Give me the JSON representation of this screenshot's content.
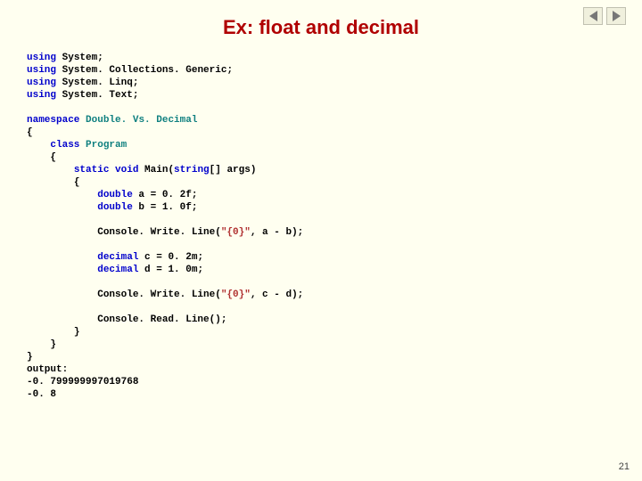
{
  "title": "Ex: float and decimal",
  "nav": {
    "prev_icon": "◄",
    "next_icon": "►"
  },
  "code": {
    "kw_using": "using",
    "ns_system": " System;",
    "ns_collections": " System. Collections. Generic;",
    "ns_linq": " System. Linq;",
    "ns_text": " System. Text;",
    "kw_namespace": "namespace",
    "ns_name": "Double. Vs. Decimal",
    "brace_open": "{",
    "brace_close": "}",
    "kw_class": "class",
    "cls_name": "Program",
    "kw_static": "static",
    "kw_void": "void",
    "main_name": " Main(",
    "kw_string": "string",
    "main_args": "[] args)",
    "kw_double": "double",
    "a_decl": " a = 0. 2f;",
    "b_decl": " b = 1. 0f;",
    "console_write1_pre": "Console. Write. Line(",
    "fmt_str": "\"{0}\"",
    "console_write1_post": ", a - b);",
    "kw_decimal": "decimal",
    "c_decl": " c = 0. 2m;",
    "d_decl": " d = 1. 0m;",
    "console_write2_post": ", c - d);",
    "console_read": "Console. Read. Line();",
    "output_label": "output:",
    "output_line1": "-0. 799999997019768",
    "output_line2": "-0. 8"
  },
  "page_number": "21"
}
